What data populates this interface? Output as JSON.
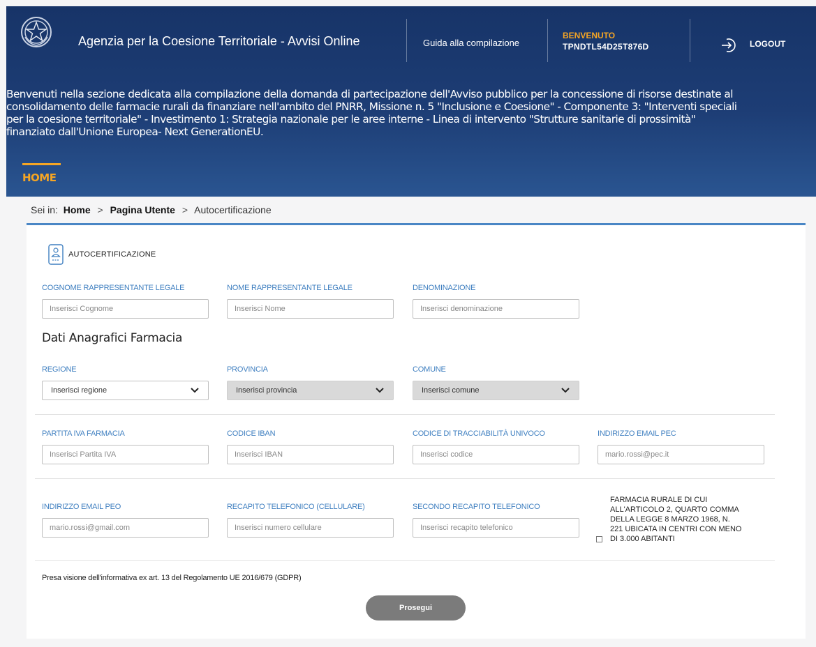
{
  "header": {
    "app_title": "Agenzia per la Coesione Territoriale - Avvisi Online",
    "guide_link": "Guida alla compilazione",
    "welcome_label": "BENVENUTO",
    "welcome_user": "TPNDTL54D25T876D",
    "logout_label": "LOGOUT",
    "intro_text": "Benvenuti nella sezione dedicata alla compilazione della domanda di partecipazione dell'Avviso pubblico per la concessione di risorse destinate al\nconsolidamento delle farmacie rurali da finanziare nell'ambito del PNRR, Missione n. 5 \"Inclusione e Coesione\" - Componente 3: \"Interventi speciali\nper la coesione territoriale\" - Investimento 1: Strategia nazionale per le aree interne - Linea di intervento \"Strutture sanitarie di prossimità\"\nfinanziato dall'Unione Europea- Next GenerationEU.",
    "home_tab": "HOME"
  },
  "breadcrumb": {
    "prefix": "Sei in:",
    "home": "Home",
    "user_page": "Pagina Utente",
    "current": "Autocertificazione",
    "separator": ">"
  },
  "form": {
    "section_title": "AUTOCERTIFICAZIONE",
    "cognome": {
      "label": "COGNOME RAPPRESENTANTE LEGALE",
      "placeholder": "Inserisci Cognome",
      "value": ""
    },
    "nome": {
      "label": "NOME RAPPRESENTANTE LEGALE",
      "placeholder": "Inserisci Nome",
      "value": ""
    },
    "denominazione": {
      "label": "DENOMINAZIONE",
      "placeholder": "Inserisci denominazione",
      "value": ""
    },
    "subheading": "Dati Anagrafici Farmacia",
    "regione": {
      "label": "REGIONE",
      "selected": "Inserisci regione"
    },
    "provincia": {
      "label": "PROVINCIA",
      "selected": "Inserisci provincia"
    },
    "comune": {
      "label": "COMUNE",
      "selected": "Inserisci comune"
    },
    "partita_iva": {
      "label": "PARTITA IVA FARMACIA",
      "placeholder": "Inserisci Partita IVA",
      "value": ""
    },
    "iban": {
      "label": "CODICE IBAN",
      "placeholder": "Inserisci IBAN",
      "value": ""
    },
    "tracciabilita": {
      "label": "CODICE DI TRACCIABILITÀ UNIVOCO",
      "placeholder": "Inserisci codice",
      "value": ""
    },
    "pec": {
      "label": "INDIRIZZO EMAIL PEC",
      "placeholder": "mario.rossi@pec.it",
      "value": ""
    },
    "peo": {
      "label": "INDIRIZZO EMAIL PEO",
      "placeholder": "mario.rossi@gmail.com",
      "value": ""
    },
    "cellulare": {
      "label": "RECAPITO TELEFONICO (CELLULARE)",
      "placeholder": "Inserisci numero cellulare",
      "value": ""
    },
    "telefono2": {
      "label": "SECONDO RECAPITO TELEFONICO",
      "placeholder": "Inserisci recapito telefonico",
      "value": ""
    },
    "rural_checkbox": {
      "label": "FARMACIA RURALE DI CUI ALL'ARTICOLO 2, QUARTO COMMA DELLA LEGGE 8 MARZO 1968, N. 221 UBICATA IN CENTRI CON MENO DI 3.000 ABITANTI",
      "checked": false
    },
    "gdpr_text": "Presa visione dell'informativa ex art. 13 del Regolamento UE 2016/679 (GDPR)",
    "submit_label": "Prosegui"
  },
  "colors": {
    "header_bg": "#1d3d75",
    "accent_orange": "#f5a524",
    "label_blue": "#3f7fc0",
    "card_top_border": "#4a86c5",
    "button_gray": "#7b7b7b"
  },
  "icons": [
    "italian-emblem-icon",
    "logout-icon",
    "id-card-icon",
    "chevron-down-icon"
  ]
}
